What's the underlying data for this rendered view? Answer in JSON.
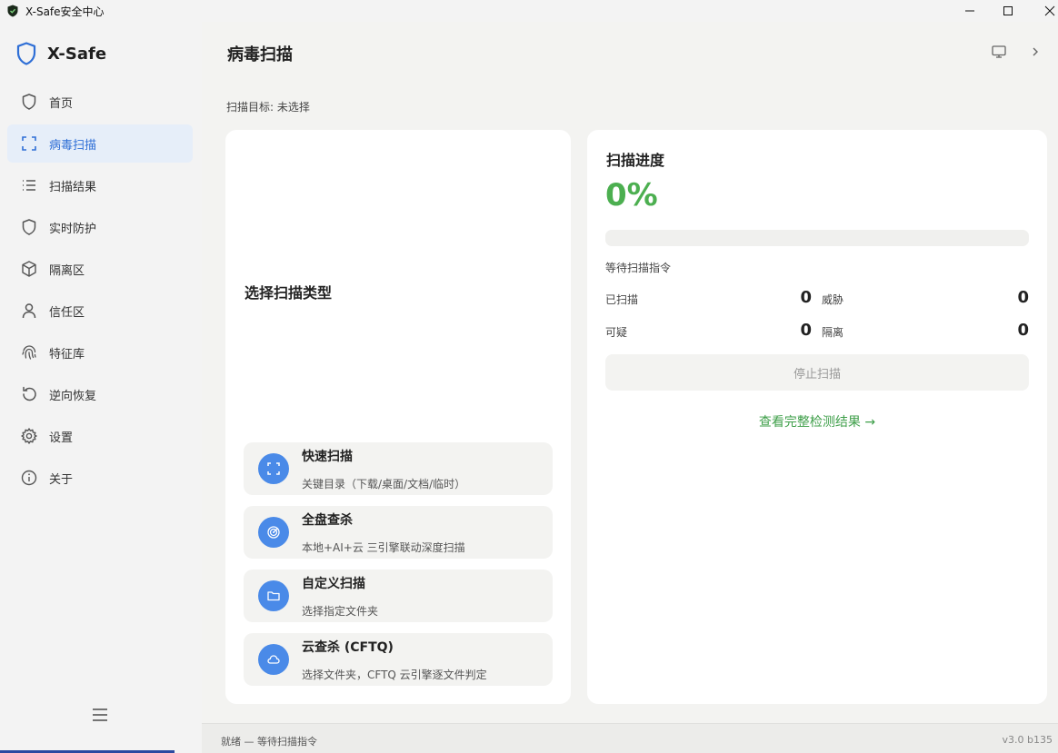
{
  "window": {
    "title": "X-Safe安全中心"
  },
  "sidebar": {
    "brand": "X-Safe",
    "items": [
      {
        "label": "首页",
        "icon": "shield-icon"
      },
      {
        "label": "病毒扫描",
        "icon": "scan-frame-icon",
        "active": true
      },
      {
        "label": "扫描结果",
        "icon": "list-icon"
      },
      {
        "label": "实时防护",
        "icon": "shield-icon"
      },
      {
        "label": "隔离区",
        "icon": "box-icon"
      },
      {
        "label": "信任区",
        "icon": "user-icon"
      },
      {
        "label": "特征库",
        "icon": "fingerprint-icon"
      },
      {
        "label": "逆向恢复",
        "icon": "restore-icon"
      },
      {
        "label": "设置",
        "icon": "gear-icon"
      },
      {
        "label": "关于",
        "icon": "info-icon"
      }
    ]
  },
  "main": {
    "title": "病毒扫描",
    "scan_target": "扫描目标: 未选择",
    "section_title": "选择扫描类型",
    "scan_options": [
      {
        "title": "快速扫描",
        "desc": "关键目录（下载/桌面/文档/临时）",
        "icon": "scan-frame-icon"
      },
      {
        "title": "全盘查杀",
        "desc": "本地+AI+云 三引擎联动深度扫描",
        "icon": "radar-icon"
      },
      {
        "title": "自定义扫描",
        "desc": "选择指定文件夹",
        "icon": "folder-icon"
      },
      {
        "title": "云查杀 (CFTQ)",
        "desc": "选择文件夹，CFTQ 云引擎逐文件判定",
        "icon": "cloud-icon"
      }
    ],
    "progress": {
      "title": "扫描进度",
      "percent_label": "0%",
      "percent": 0,
      "status": "等待扫描指令",
      "stats": {
        "scanned_label": "已扫描",
        "scanned": "0",
        "threats_label": "威胁",
        "threats": "0",
        "suspicious_label": "可疑",
        "suspicious": "0",
        "quarantined_label": "隔离",
        "quarantined": "0"
      },
      "stop_label": "停止扫描",
      "results_link": "查看完整检测结果 →"
    }
  },
  "statusbar": {
    "left": "就绪 — 等待扫描指令",
    "right": "v3.0 b135"
  },
  "colors": {
    "accent_blue": "#4a8ae8",
    "accent_green": "#4caf50",
    "active_nav_bg": "#e6eef9"
  }
}
